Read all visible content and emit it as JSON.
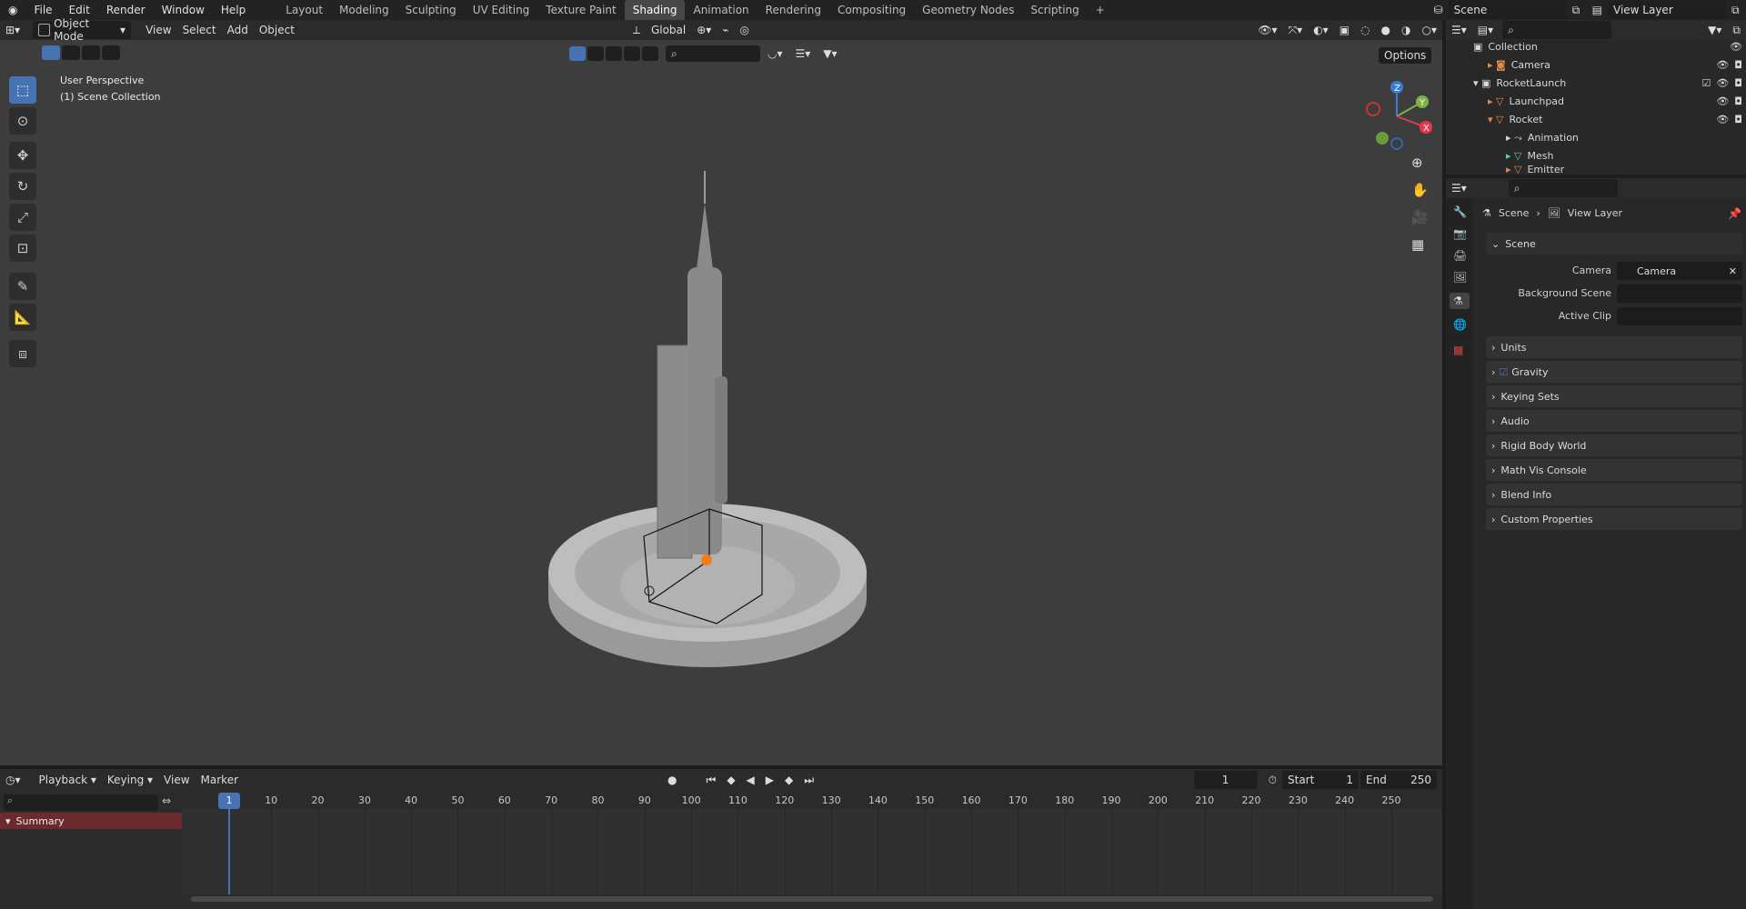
{
  "topbar": {
    "menus": [
      "File",
      "Edit",
      "Render",
      "Window",
      "Help"
    ],
    "workspaces": [
      "Layout",
      "Modeling",
      "Sculpting",
      "UV Editing",
      "Texture Paint",
      "Shading",
      "Animation",
      "Rendering",
      "Compositing",
      "Geometry Nodes",
      "Scripting"
    ],
    "active_workspace": "Shading",
    "add_tab": "+",
    "scene": "Scene",
    "view_layer": "View Layer"
  },
  "viewport_header": {
    "mode": "Object Mode",
    "menus": [
      "View",
      "Select",
      "Add",
      "Object"
    ],
    "orientation": "Global",
    "options": "Options"
  },
  "viewport": {
    "perspective": "User Perspective",
    "collection": "(1) Scene Collection",
    "gizmo": {
      "x": "X",
      "y": "Y",
      "z": "Z"
    }
  },
  "outliner": {
    "rows": [
      {
        "name": "Collection",
        "indent": 0
      },
      {
        "name": "Camera",
        "indent": 1
      },
      {
        "name": "RocketLaunch",
        "indent": 0
      },
      {
        "name": "Launchpad",
        "indent": 1
      },
      {
        "name": "Rocket",
        "indent": 1
      },
      {
        "name": "Animation",
        "indent": 2
      },
      {
        "name": "Mesh",
        "indent": 2
      },
      {
        "name": "Emitter",
        "indent": 2
      }
    ]
  },
  "properties": {
    "breadcrumb_scene": "Scene",
    "breadcrumb_layer": "View Layer",
    "scene_panel": "Scene",
    "camera_label": "Camera",
    "camera_value": "Camera",
    "background_label": "Background Scene",
    "clip_label": "Active Clip",
    "panels": [
      "Units",
      "Gravity",
      "Keying Sets",
      "Audio",
      "Rigid Body World",
      "Math Vis Console",
      "Blend Info",
      "Custom Properties"
    ]
  },
  "timeline": {
    "menus": [
      "Playback",
      "Keying",
      "View",
      "Marker"
    ],
    "current_frame": "1",
    "start_label": "Start",
    "start": "1",
    "end_label": "End",
    "end": "250",
    "ticks": [
      "1",
      "10",
      "20",
      "30",
      "40",
      "50",
      "60",
      "70",
      "80",
      "90",
      "100",
      "110",
      "120",
      "130",
      "140",
      "150",
      "160",
      "170",
      "180",
      "190",
      "200",
      "210",
      "220",
      "230",
      "240",
      "250"
    ],
    "summary": "Summary"
  }
}
